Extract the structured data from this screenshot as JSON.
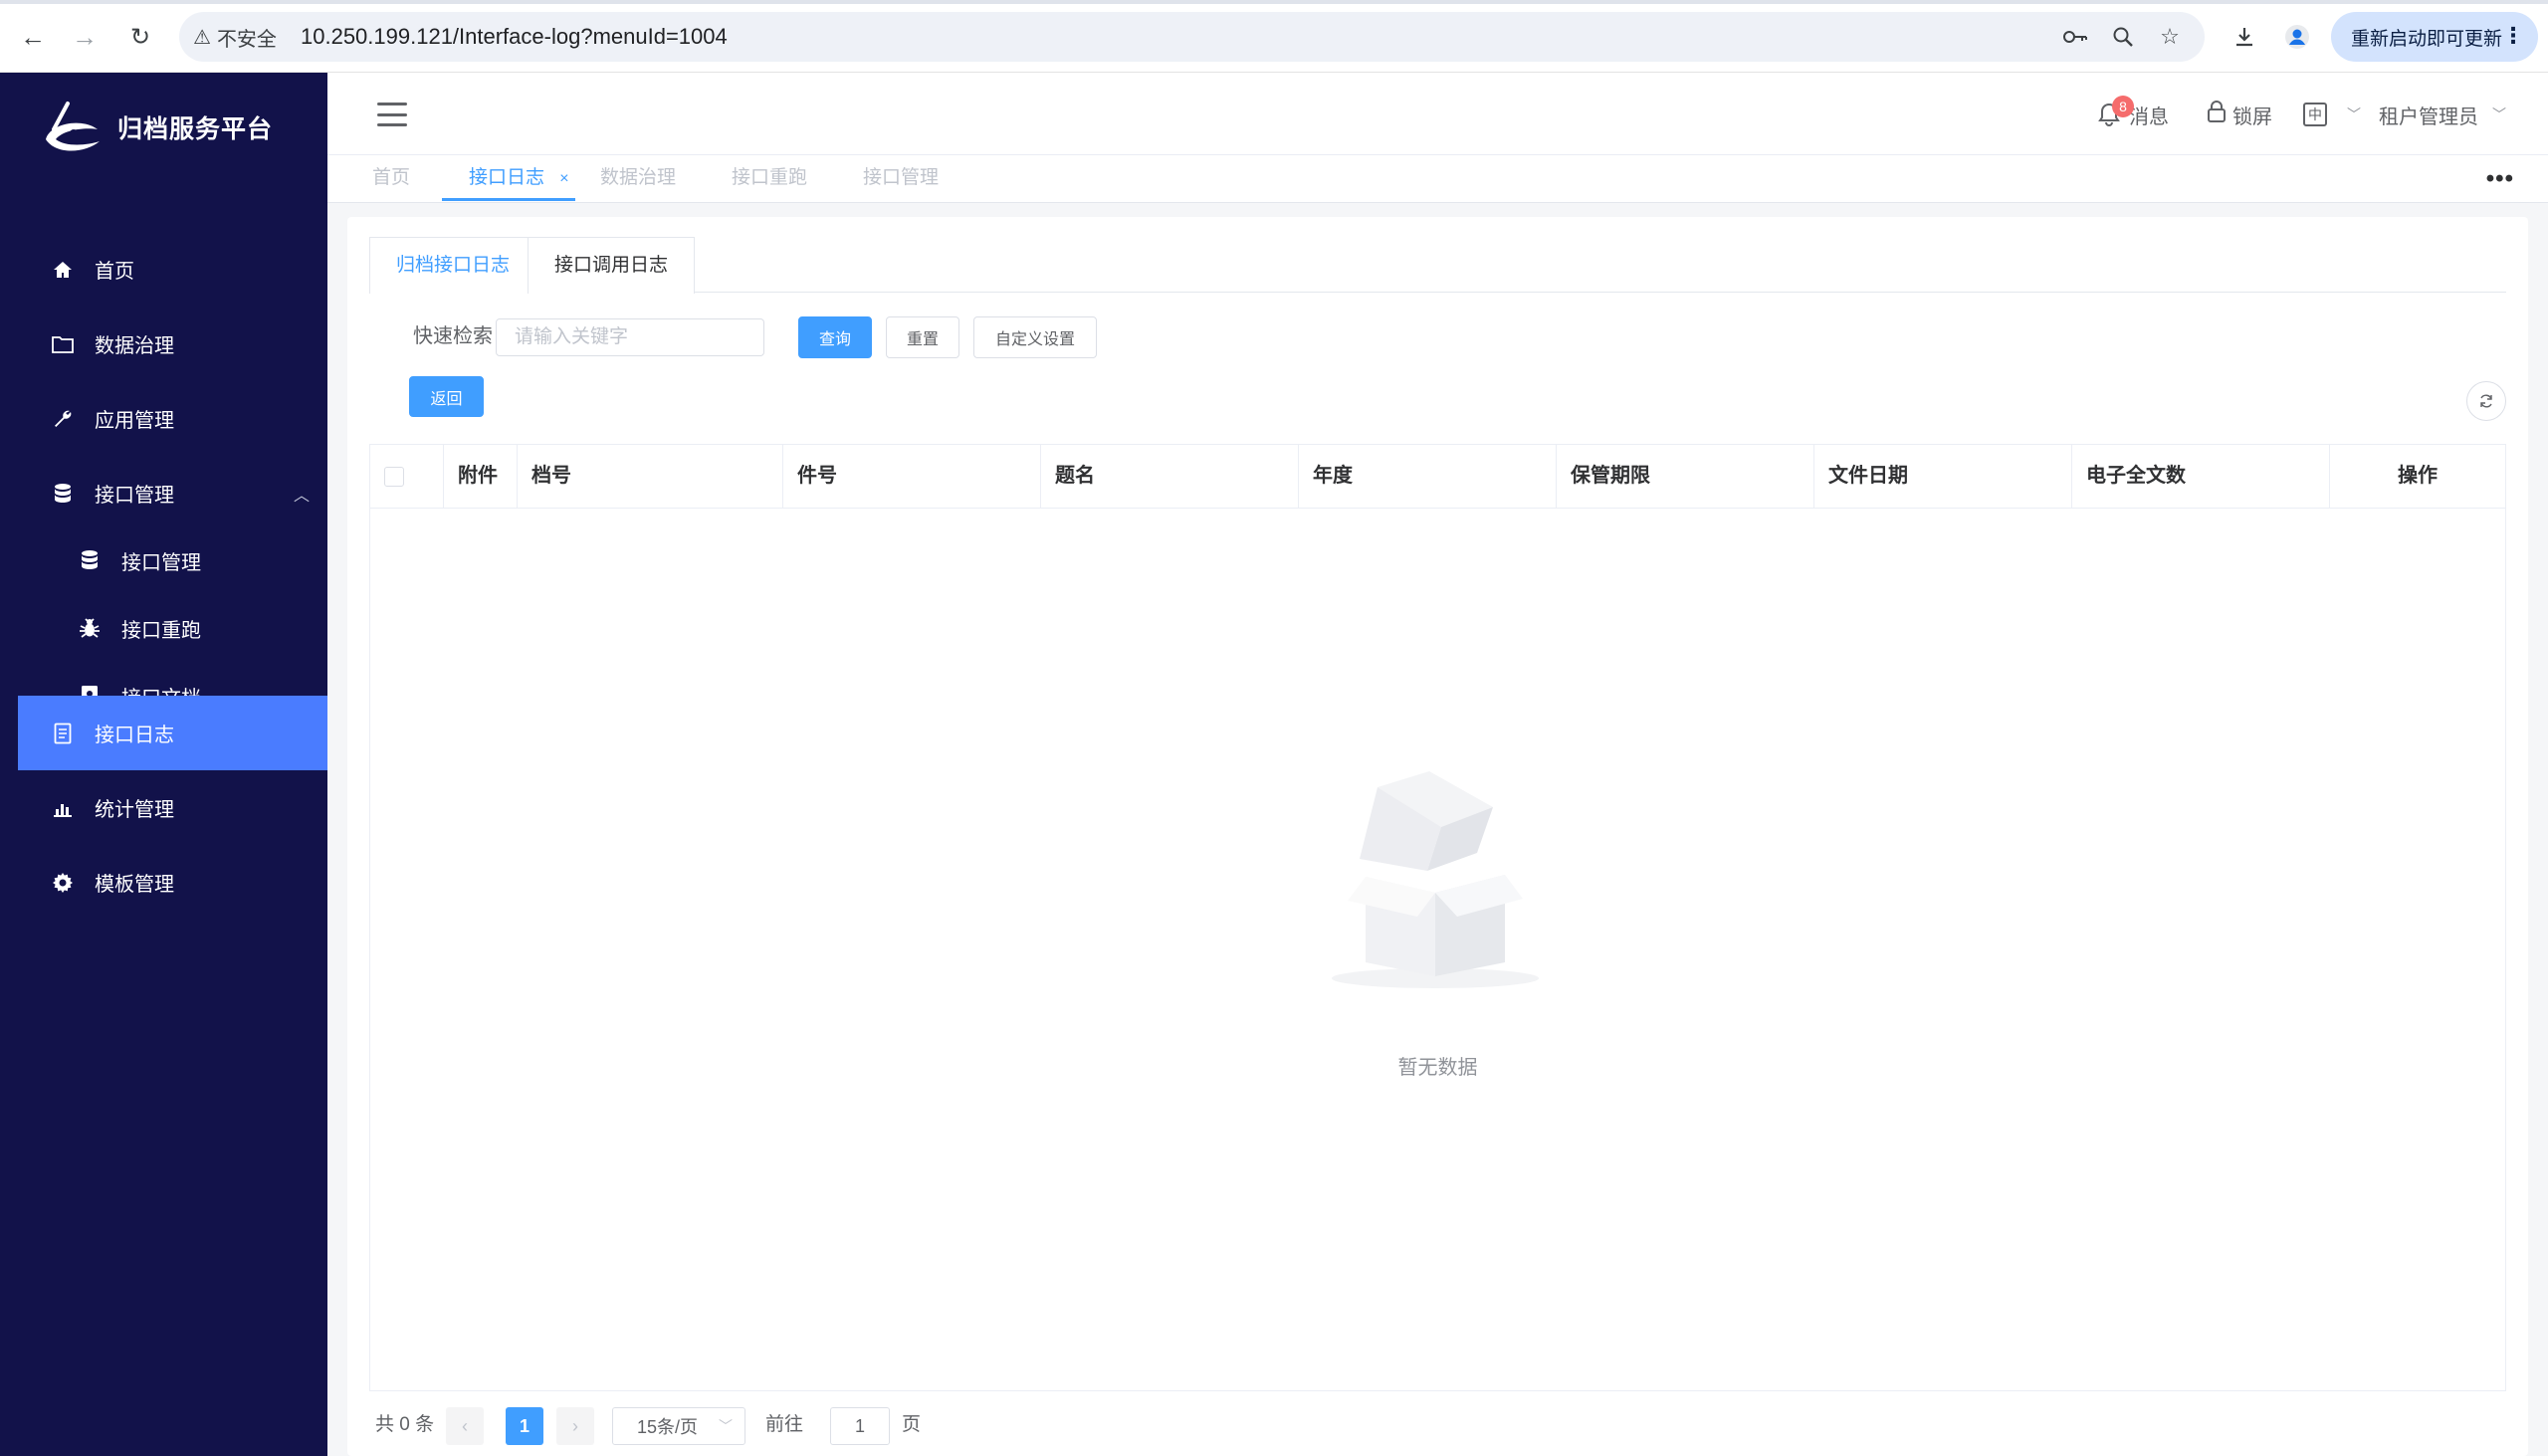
{
  "browser": {
    "security_label": "不安全",
    "url": "10.250.199.121/Interface-log?menuId=1004",
    "update_label": "重新启动即可更新"
  },
  "app": {
    "brand_name": "归档服务平台"
  },
  "sidebar": {
    "items": [
      {
        "label": "首页",
        "icon": "home-icon"
      },
      {
        "label": "数据治理",
        "icon": "folder-icon"
      },
      {
        "label": "应用管理",
        "icon": "wrench-icon"
      },
      {
        "label": "接口管理",
        "icon": "database-icon",
        "expanded": true
      },
      {
        "label": "接口管理",
        "icon": "database-icon",
        "sub": true
      },
      {
        "label": "接口重跑",
        "icon": "bug-icon",
        "sub": true
      },
      {
        "label": "接口文档",
        "icon": "contact-book-icon",
        "sub": true
      },
      {
        "label": "接口日志",
        "icon": "document-icon",
        "active": true
      },
      {
        "label": "统计管理",
        "icon": "bar-chart-icon"
      },
      {
        "label": "模板管理",
        "icon": "gear-icon"
      }
    ]
  },
  "header": {
    "messages_label": "消息",
    "messages_badge": "8",
    "lock_label": "锁屏",
    "lang_label": "中",
    "user_label": "租户管理员"
  },
  "tags": [
    {
      "label": "首页",
      "active": false
    },
    {
      "label": "接口日志",
      "active": true,
      "close": "×"
    },
    {
      "label": "数据治理",
      "active": false
    },
    {
      "label": "接口重跑",
      "active": false
    },
    {
      "label": "接口管理",
      "active": false
    }
  ],
  "tags_more": "•••",
  "inner_tabs": [
    {
      "label": "归档接口日志",
      "active": true
    },
    {
      "label": "接口调用日志",
      "active": false
    }
  ],
  "search": {
    "label": "快速检索",
    "placeholder": "请输入关键字",
    "query_label": "查询",
    "reset_label": "重置",
    "custom_label": "自定义设置",
    "back_label": "返回"
  },
  "table": {
    "columns": [
      "附件",
      "档号",
      "件号",
      "题名",
      "年度",
      "保管期限",
      "文件日期",
      "电子全文数",
      "操作"
    ],
    "rows": [],
    "empty_text": "暂无数据"
  },
  "pagination": {
    "total_text": "共 0 条",
    "current_page": "1",
    "page_size": "15条/页",
    "goto_prefix": "前往",
    "goto_value": "1",
    "goto_suffix": "页"
  },
  "colors": {
    "sidebar_bg": "#12124a",
    "active_item": "#4a7cff",
    "primary": "#409eff",
    "badge": "#f56c6c"
  }
}
